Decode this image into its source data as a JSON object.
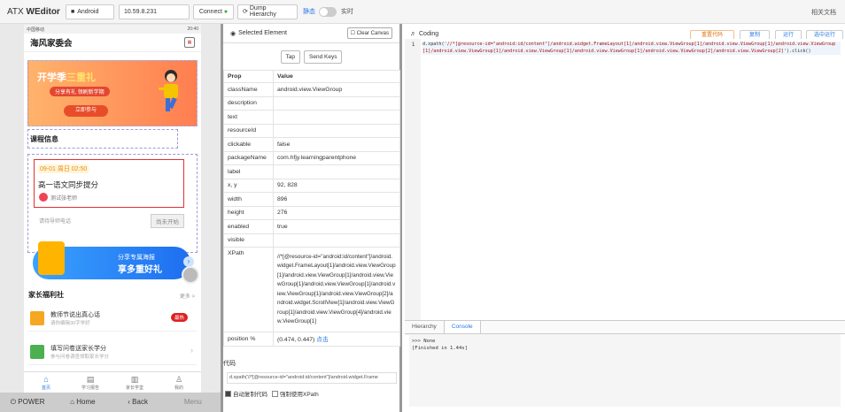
{
  "topbar": {
    "brand_prefix": "ATX",
    "brand_name": "WEditor",
    "platform": "Android",
    "ip": "10.59.8.231",
    "connect_label": "Connect",
    "dump_label": "Dump Hierarchy",
    "static_label": "静态",
    "live_label": "实时",
    "help_label": "相关文档"
  },
  "phone": {
    "statusbar_left": "中国移动",
    "statusbar_right": "20:40",
    "app_title": "海风家委会",
    "banner": {
      "title_part1": "开学季",
      "title_part2": "三重礼",
      "subtitle": "分享有礼 领刷新学期",
      "button": "立即参与"
    },
    "course_heading": "课程信息",
    "course": {
      "time": "09-01 周日 02:50",
      "name": "高一语文同步提分",
      "teacher": "测试张老师",
      "note": "请待导师电话",
      "status_button": "尚未开始"
    },
    "share": {
      "line1": "分享专属海报",
      "line2": "享多重好礼"
    },
    "welfare_heading": "家长福利社",
    "welfare_more": "更多 >",
    "welfare_items": [
      {
        "title": "教师节说出真心话",
        "desc": "请你编辑30字学好",
        "badge": "最热"
      },
      {
        "title": "填写问卷送家长学分",
        "desc": "参与问卷调查领取家长学分"
      }
    ],
    "tabs": [
      "首页",
      "学习报告",
      "家长学堂",
      "我的"
    ],
    "controls": {
      "power": "POWER",
      "home": "Home",
      "back": "Back",
      "menu": "Menu"
    }
  },
  "selected": {
    "title": "Selected Element",
    "clear_canvas": "Clear Canvas",
    "tap_label": "Tap",
    "send_keys_label": "Send Keys",
    "header_prop": "Prop",
    "header_value": "Value",
    "props": [
      {
        "k": "className",
        "v": "android.view.ViewGroup"
      },
      {
        "k": "description",
        "v": ""
      },
      {
        "k": "text",
        "v": ""
      },
      {
        "k": "resourceId",
        "v": ""
      },
      {
        "k": "clickable",
        "v": "false"
      },
      {
        "k": "packageName",
        "v": "com.hfjy.learningparentphone"
      },
      {
        "k": "label",
        "v": ""
      },
      {
        "k": "x, y",
        "v": "92, 828"
      },
      {
        "k": "width",
        "v": "896"
      },
      {
        "k": "height",
        "v": "276"
      },
      {
        "k": "enabled",
        "v": "true"
      },
      {
        "k": "visible",
        "v": ""
      }
    ],
    "xpath_key": "XPath",
    "xpath_value": "//*[@resource-id=\"android:id/content\"]/android.widget.FrameLayout[1]/android.view.ViewGroup[1]/android.view.ViewGroup[1]/android.view.ViewGroup[1]/android.view.ViewGroup[1]/android.view.ViewGroup[1]/android.view.ViewGroup[2]/android.widget.ScrollView[1]/android.view.ViewGroup[1]/android.view.ViewGroup[4]/android.view.ViewGroup[1]",
    "position_key": "position %",
    "position_value": "(0.474, 0.447)",
    "position_link": "点击",
    "code_label": "代码",
    "xpath_preview": "d.xpath('//*[@resource-id=\"android:id/content\"]/android.widget.Frame",
    "auto_copy_label": "自动复制代码",
    "force_xpath_label": "强制使用XPath"
  },
  "coding": {
    "title": "Coding",
    "reset_label": "重置代码",
    "copy_label": "复制",
    "run_label": "运行",
    "run_line_label": "选中运行",
    "line_number": "1",
    "code_prefix": "d.xpath(",
    "code_string": "'//*[@resource-id=\"android:id/content\"]/android.widget.FrameLayout[1]/android.view.ViewGroup[1]/android.view.ViewGroup[1]/android.view.ViewGroup[1]/android.view.ViewGroup[1]/android.view.ViewGroup[1]/android.view.ViewGroup[1]/android.view.ViewGroup[2]/android.view.ViewGroup[2]'",
    "code_suffix": ").click()",
    "tab_hierarchy": "Hierarchy",
    "tab_console": "Console",
    "console_line1": ">>> None",
    "console_line2": "[Finished in 1.44s]"
  },
  "colors": {
    "accent": "#2a7be4",
    "selection": "#d33"
  }
}
